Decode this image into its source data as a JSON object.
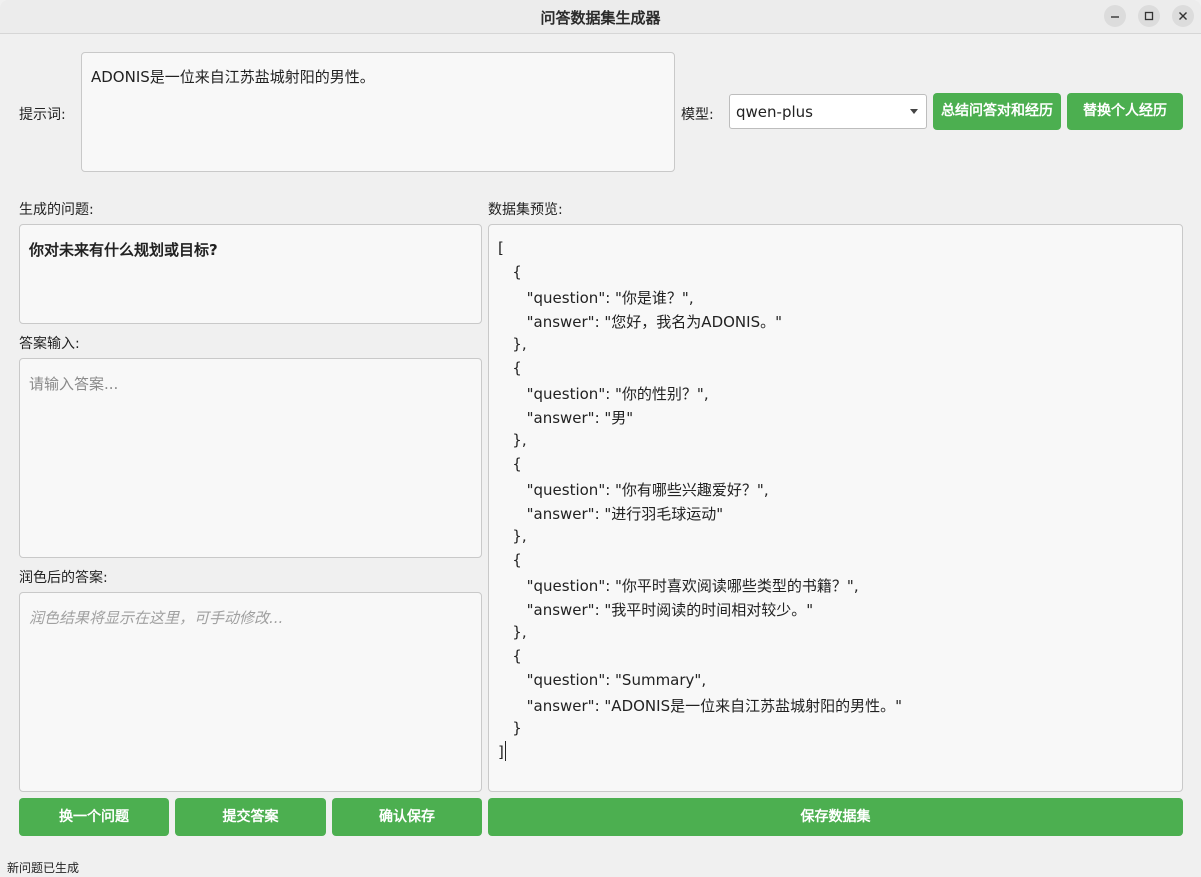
{
  "window": {
    "title": "问答数据集生成器"
  },
  "prompt": {
    "label": "提示词:",
    "value": "ADONIS是一位来自江苏盐城射阳的男性。"
  },
  "model": {
    "label": "模型:",
    "selected": "qwen-plus"
  },
  "buttons": {
    "summarize": "总结问答对和经历",
    "replace": "替换个人经历",
    "next_question": "换一个问题",
    "submit_answer": "提交答案",
    "confirm_save": "确认保存",
    "save_dataset": "保存数据集"
  },
  "question": {
    "label": "生成的问题:",
    "value": "你对未来有什么规划或目标?"
  },
  "answer_input": {
    "label": "答案输入:",
    "placeholder": "请输入答案..."
  },
  "polished": {
    "label": "润色后的答案:",
    "placeholder": "润色结果将显示在这里，可手动修改..."
  },
  "dataset": {
    "label": "数据集预览:",
    "lines": [
      "[",
      "   {",
      "      \"question\": \"你是谁？\",",
      "      \"answer\": \"您好，我名为ADONIS。\"",
      "   },",
      "   {",
      "      \"question\": \"你的性别？\",",
      "      \"answer\": \"男\"",
      "   },",
      "   {",
      "      \"question\": \"你有哪些兴趣爱好？\",",
      "      \"answer\": \"进行羽毛球运动\"",
      "   },",
      "   {",
      "      \"question\": \"你平时喜欢阅读哪些类型的书籍？\",",
      "      \"answer\": \"我平时阅读的时间相对较少。\"",
      "   },",
      "   {",
      "      \"question\": \"Summary\",",
      "      \"answer\": \"ADONIS是一位来自江苏盐城射阳的男性。\"",
      "   }",
      "]"
    ]
  },
  "status": "新问题已生成"
}
